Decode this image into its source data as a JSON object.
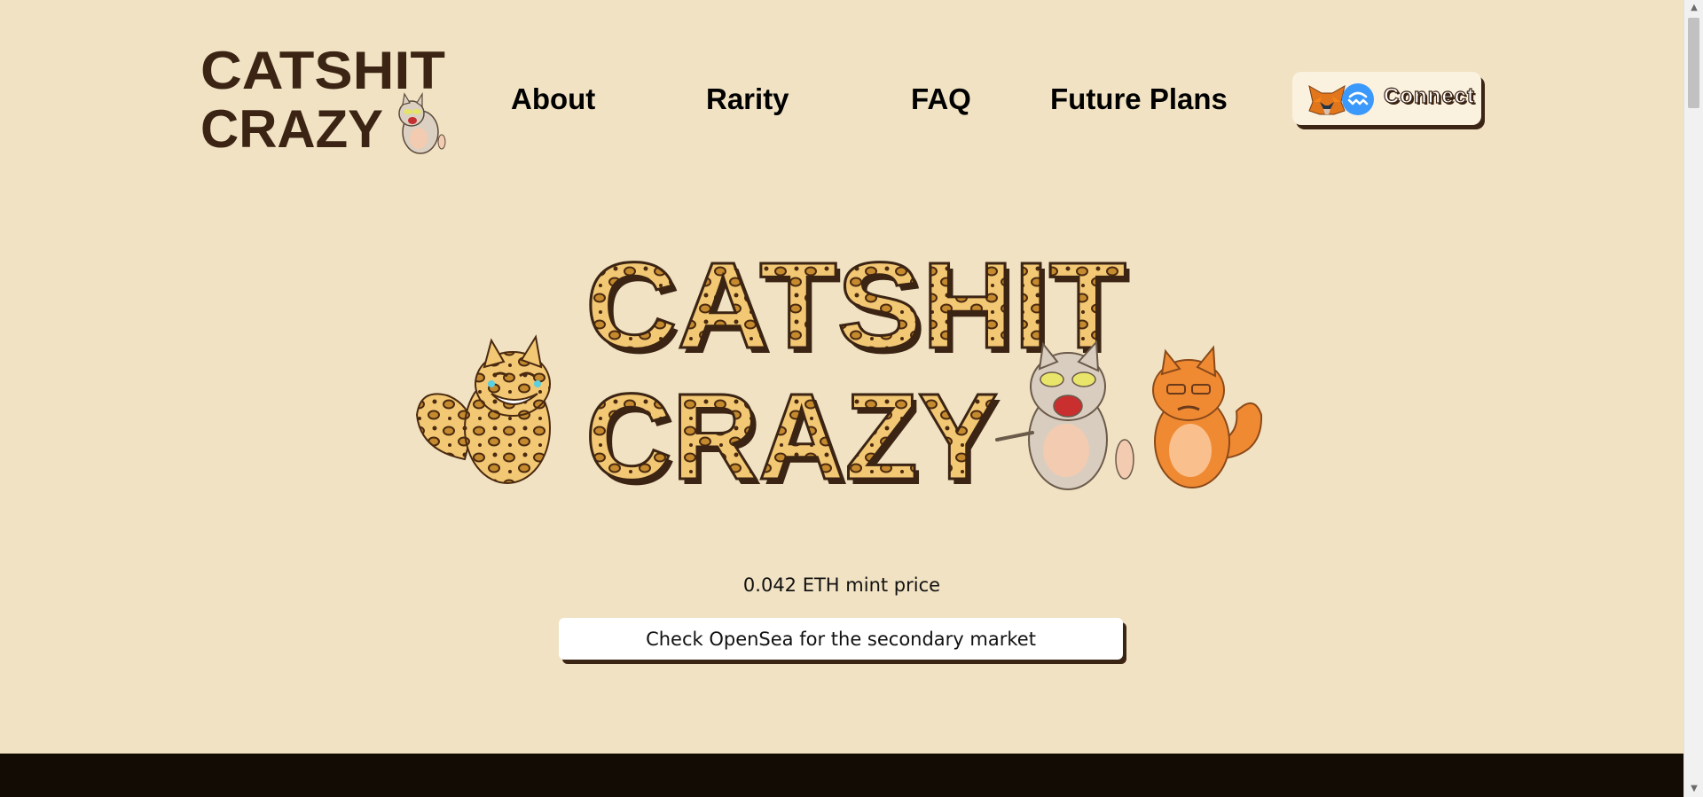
{
  "logo": {
    "line1": "CATSHIT",
    "line2": "CRAZY"
  },
  "nav": {
    "items": [
      {
        "label": "About"
      },
      {
        "label": "Rarity"
      },
      {
        "label": "FAQ"
      },
      {
        "label": "Future Plans"
      }
    ]
  },
  "connect": {
    "label": "Connect",
    "icons": [
      "metamask-fox-icon",
      "walletconnect-icon"
    ]
  },
  "hero": {
    "title_line1": "CATSHIT",
    "title_line2": "CRAZY"
  },
  "mint": {
    "price_text": "0.042 ETH mint price"
  },
  "market": {
    "button_label": "Check OpenSea for the secondary market"
  },
  "colors": {
    "background": "#f1e2c3",
    "brand_brown": "#3b2413",
    "footer": "#130c05",
    "leopard": "#f3c874",
    "orange_cat": "#f08a32"
  }
}
